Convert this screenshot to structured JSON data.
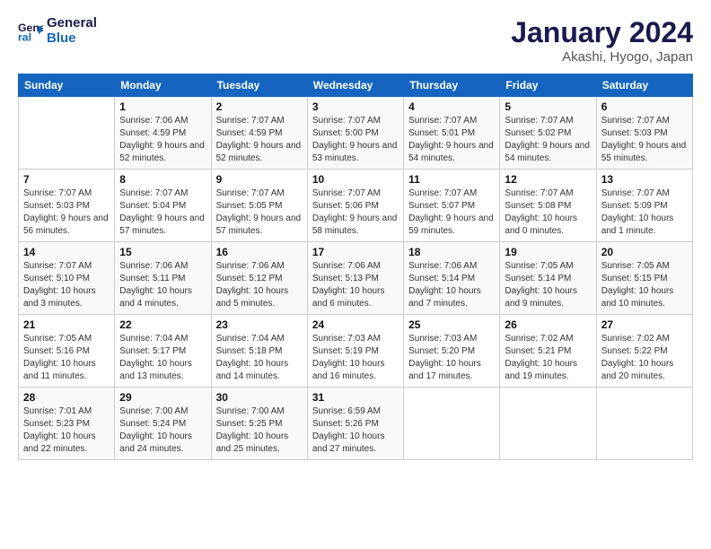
{
  "header": {
    "logo_line1": "General",
    "logo_line2": "Blue",
    "month": "January 2024",
    "location": "Akashi, Hyogo, Japan"
  },
  "weekdays": [
    "Sunday",
    "Monday",
    "Tuesday",
    "Wednesday",
    "Thursday",
    "Friday",
    "Saturday"
  ],
  "weeks": [
    [
      {
        "day": "",
        "sunrise": "",
        "sunset": "",
        "daylight": ""
      },
      {
        "day": "1",
        "sunrise": "7:06 AM",
        "sunset": "4:59 PM",
        "daylight": "9 hours and 52 minutes."
      },
      {
        "day": "2",
        "sunrise": "7:07 AM",
        "sunset": "4:59 PM",
        "daylight": "9 hours and 52 minutes."
      },
      {
        "day": "3",
        "sunrise": "7:07 AM",
        "sunset": "5:00 PM",
        "daylight": "9 hours and 53 minutes."
      },
      {
        "day": "4",
        "sunrise": "7:07 AM",
        "sunset": "5:01 PM",
        "daylight": "9 hours and 54 minutes."
      },
      {
        "day": "5",
        "sunrise": "7:07 AM",
        "sunset": "5:02 PM",
        "daylight": "9 hours and 54 minutes."
      },
      {
        "day": "6",
        "sunrise": "7:07 AM",
        "sunset": "5:03 PM",
        "daylight": "9 hours and 55 minutes."
      }
    ],
    [
      {
        "day": "7",
        "sunrise": "7:07 AM",
        "sunset": "5:03 PM",
        "daylight": "9 hours and 56 minutes."
      },
      {
        "day": "8",
        "sunrise": "7:07 AM",
        "sunset": "5:04 PM",
        "daylight": "9 hours and 57 minutes."
      },
      {
        "day": "9",
        "sunrise": "7:07 AM",
        "sunset": "5:05 PM",
        "daylight": "9 hours and 57 minutes."
      },
      {
        "day": "10",
        "sunrise": "7:07 AM",
        "sunset": "5:06 PM",
        "daylight": "9 hours and 58 minutes."
      },
      {
        "day": "11",
        "sunrise": "7:07 AM",
        "sunset": "5:07 PM",
        "daylight": "9 hours and 59 minutes."
      },
      {
        "day": "12",
        "sunrise": "7:07 AM",
        "sunset": "5:08 PM",
        "daylight": "10 hours and 0 minutes."
      },
      {
        "day": "13",
        "sunrise": "7:07 AM",
        "sunset": "5:09 PM",
        "daylight": "10 hours and 1 minute."
      }
    ],
    [
      {
        "day": "14",
        "sunrise": "7:07 AM",
        "sunset": "5:10 PM",
        "daylight": "10 hours and 3 minutes."
      },
      {
        "day": "15",
        "sunrise": "7:06 AM",
        "sunset": "5:11 PM",
        "daylight": "10 hours and 4 minutes."
      },
      {
        "day": "16",
        "sunrise": "7:06 AM",
        "sunset": "5:12 PM",
        "daylight": "10 hours and 5 minutes."
      },
      {
        "day": "17",
        "sunrise": "7:06 AM",
        "sunset": "5:13 PM",
        "daylight": "10 hours and 6 minutes."
      },
      {
        "day": "18",
        "sunrise": "7:06 AM",
        "sunset": "5:14 PM",
        "daylight": "10 hours and 7 minutes."
      },
      {
        "day": "19",
        "sunrise": "7:05 AM",
        "sunset": "5:14 PM",
        "daylight": "10 hours and 9 minutes."
      },
      {
        "day": "20",
        "sunrise": "7:05 AM",
        "sunset": "5:15 PM",
        "daylight": "10 hours and 10 minutes."
      }
    ],
    [
      {
        "day": "21",
        "sunrise": "7:05 AM",
        "sunset": "5:16 PM",
        "daylight": "10 hours and 11 minutes."
      },
      {
        "day": "22",
        "sunrise": "7:04 AM",
        "sunset": "5:17 PM",
        "daylight": "10 hours and 13 minutes."
      },
      {
        "day": "23",
        "sunrise": "7:04 AM",
        "sunset": "5:18 PM",
        "daylight": "10 hours and 14 minutes."
      },
      {
        "day": "24",
        "sunrise": "7:03 AM",
        "sunset": "5:19 PM",
        "daylight": "10 hours and 16 minutes."
      },
      {
        "day": "25",
        "sunrise": "7:03 AM",
        "sunset": "5:20 PM",
        "daylight": "10 hours and 17 minutes."
      },
      {
        "day": "26",
        "sunrise": "7:02 AM",
        "sunset": "5:21 PM",
        "daylight": "10 hours and 19 minutes."
      },
      {
        "day": "27",
        "sunrise": "7:02 AM",
        "sunset": "5:22 PM",
        "daylight": "10 hours and 20 minutes."
      }
    ],
    [
      {
        "day": "28",
        "sunrise": "7:01 AM",
        "sunset": "5:23 PM",
        "daylight": "10 hours and 22 minutes."
      },
      {
        "day": "29",
        "sunrise": "7:00 AM",
        "sunset": "5:24 PM",
        "daylight": "10 hours and 24 minutes."
      },
      {
        "day": "30",
        "sunrise": "7:00 AM",
        "sunset": "5:25 PM",
        "daylight": "10 hours and 25 minutes."
      },
      {
        "day": "31",
        "sunrise": "6:59 AM",
        "sunset": "5:26 PM",
        "daylight": "10 hours and 27 minutes."
      },
      {
        "day": "",
        "sunrise": "",
        "sunset": "",
        "daylight": ""
      },
      {
        "day": "",
        "sunrise": "",
        "sunset": "",
        "daylight": ""
      },
      {
        "day": "",
        "sunrise": "",
        "sunset": "",
        "daylight": ""
      }
    ]
  ],
  "labels": {
    "sunrise_prefix": "Sunrise: ",
    "sunset_prefix": "Sunset: ",
    "daylight_prefix": "Daylight: "
  }
}
